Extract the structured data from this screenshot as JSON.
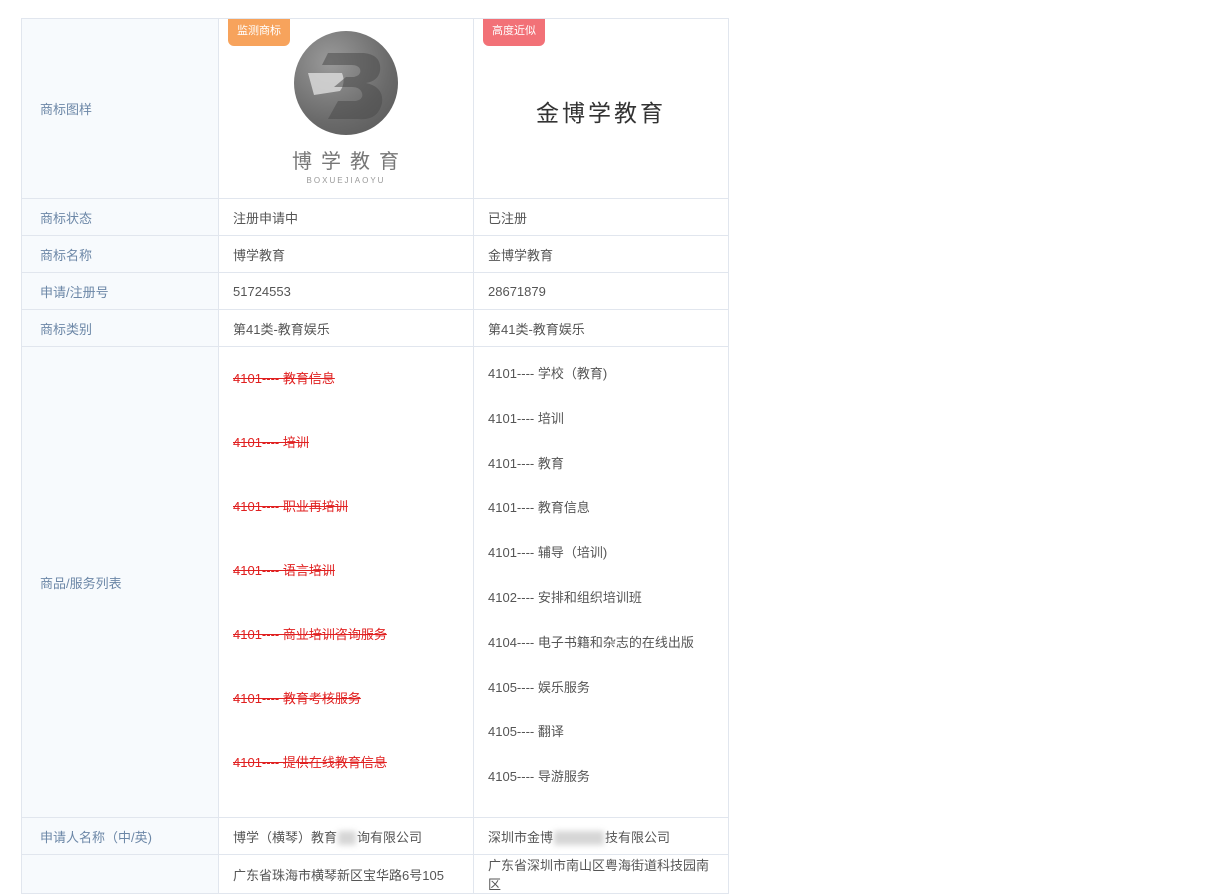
{
  "labels": {
    "logo": "商标图样",
    "status": "商标状态",
    "name": "商标名称",
    "reg_no": "申请/注册号",
    "category": "商标类别",
    "goods": "商品/服务列表",
    "applicant": "申请人名称（中/英)"
  },
  "left": {
    "badge": "监测商标",
    "logo_cn": "博学教育",
    "logo_en": "BOXUEJIAOYU",
    "status": "注册申请中",
    "name": "博学教育",
    "reg_no": "51724553",
    "category": "第41类-教育娱乐",
    "goods": [
      "4101---- 教育信息",
      "4101---- 培训",
      "4101---- 职业再培训",
      "4101---- 语言培训",
      "4101---- 商业培训咨询服务",
      "4101---- 教育考核服务",
      "4101---- 提供在线教育信息"
    ],
    "applicant_prefix": "博学（横琴）",
    "applicant_mid": "教育",
    "applicant_suffix": "询有限公司",
    "address": "广东省珠海市横琴新区宝华路6号105"
  },
  "right": {
    "badge": "高度近似",
    "logo_text": "金博学教育",
    "status": "已注册",
    "name": "金博学教育",
    "reg_no": "28671879",
    "category": "第41类-教育娱乐",
    "goods": [
      "4101---- 学校（教育)",
      "4101---- 培训",
      "4101---- 教育",
      "4101---- 教育信息",
      "4101---- 辅导（培训)",
      "4102---- 安排和组织培训班",
      "4104---- 电子书籍和杂志的在线出版",
      "4105---- 娱乐服务",
      "4105---- 翻译",
      "4105---- 导游服务"
    ],
    "applicant_prefix": "深圳市金博",
    "applicant_suffix": "技有限公司",
    "address": "广东省深圳市南山区粤海街道科技园南区"
  },
  "colors": {
    "label_bg": "#f7fafd",
    "label_text": "#6c87a7",
    "badge_monitor": "#f7a35c",
    "badge_similar": "#f27177",
    "strike_red": "#e02020"
  }
}
